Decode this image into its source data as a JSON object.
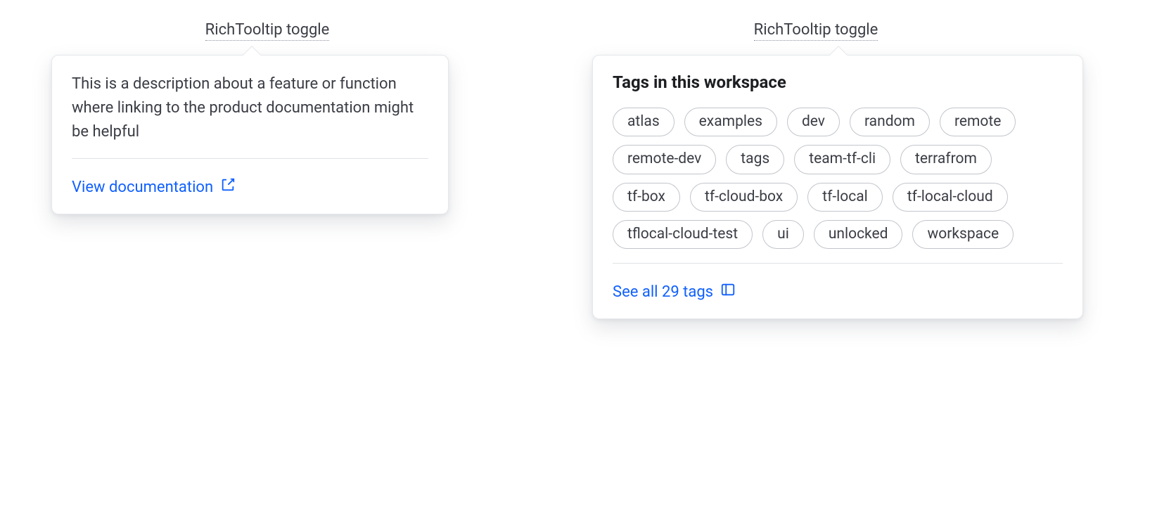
{
  "left": {
    "toggle_label": "RichTooltip toggle",
    "description": "This is a description about a feature or function where linking to the product documentation might be helpful",
    "link_label": "View documentation"
  },
  "right": {
    "toggle_label": "RichTooltip toggle",
    "title": "Tags in this workspace",
    "tags": [
      "atlas",
      "examples",
      "dev",
      "random",
      "remote",
      "remote-dev",
      "tags",
      "team-tf-cli",
      "terrafrom",
      "tf-box",
      "tf-cloud-box",
      "tf-local",
      "tf-local-cloud",
      "tflocal-cloud-test",
      "ui",
      "unlocked",
      "workspace"
    ],
    "link_label": "See all 29 tags",
    "tag_count": 29
  }
}
